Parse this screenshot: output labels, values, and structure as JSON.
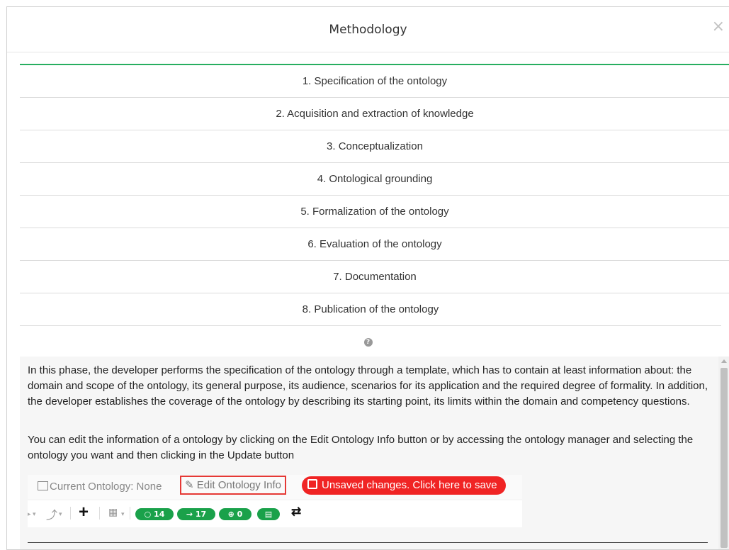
{
  "modal": {
    "title": "Methodology",
    "close_label": "×"
  },
  "phases": [
    "1. Specification of the ontology",
    "2. Acquisition and extraction of knowledge",
    "3. Conceptualization",
    "4. Ontological grounding",
    "5. Formalization of the ontology",
    "6. Evaluation of the ontology",
    "7. Documentation",
    "8. Publication of the ontology"
  ],
  "help_icon": "question-circle-icon",
  "content": {
    "paragraph1": "In this phase, the developer performs the specification of the ontology through a template, which has to contain at least information about: the domain and scope of the ontology, its general purpose, its audience, scenarios for its application and the required degree of formality. In addition, the developer establishes the coverage of the ontology by describing its starting point, its limits within the domain and competency questions.",
    "paragraph2": "You can edit the information of a ontology by clicking on the Edit Ontology Info button or by accessing the ontology manager and selecting the ontology you want and then clicking in the Update button"
  },
  "toolbar": {
    "current_ontology": "Current Ontology: None",
    "edit_button": "Edit Ontology Info",
    "unsaved_button": "Unsaved changes. Click here to save",
    "plus_label": "+",
    "counts": {
      "classes": "○ 14",
      "relations": "→ 17",
      "instances": "⊕ 0",
      "doc": "▤"
    },
    "swap_label": "⇄"
  },
  "colors": {
    "accent_green": "#27ae60",
    "pill_green": "#1aa14a",
    "alert_red": "#f02424",
    "highlight_border": "#e53935"
  }
}
